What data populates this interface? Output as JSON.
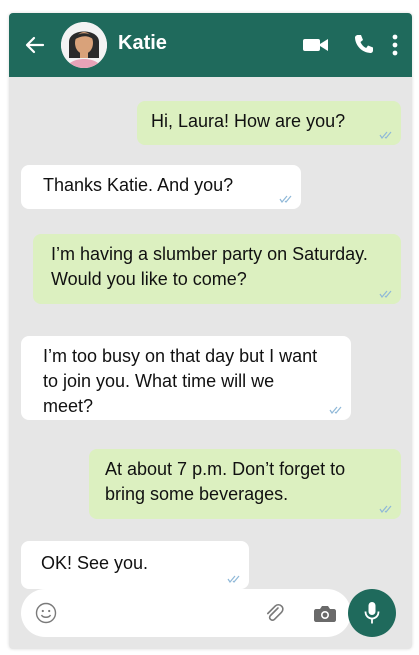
{
  "header": {
    "contact_name": "Katie",
    "color": "#1f6a5c",
    "icons": [
      "back-arrow-icon",
      "avatar",
      "video-call-icon",
      "phone-call-icon",
      "more-menu-icon"
    ]
  },
  "messages": [
    {
      "direction": "outgoing",
      "text": "Hi, Laura! How are you?"
    },
    {
      "direction": "incoming",
      "text": "Thanks Katie. And you?"
    },
    {
      "direction": "outgoing",
      "text": "I’m having a slumber party on Saturday. Would you like to come?"
    },
    {
      "direction": "incoming",
      "text": "I’m too busy on that day but I want to join you. What time will we meet?"
    },
    {
      "direction": "outgoing",
      "text": "At about 7 p.m. Don’t forget to bring some beverages."
    },
    {
      "direction": "incoming",
      "text": "OK! See you."
    }
  ],
  "colors": {
    "outgoing_bubble": "#dcf0c0",
    "incoming_bubble": "#ffffff",
    "chat_background": "#e6e6e6",
    "tick": "#8fb8d8"
  },
  "composer": {
    "icons": [
      "smiley-icon",
      "paperclip-icon",
      "camera-icon",
      "microphone-icon"
    ]
  }
}
